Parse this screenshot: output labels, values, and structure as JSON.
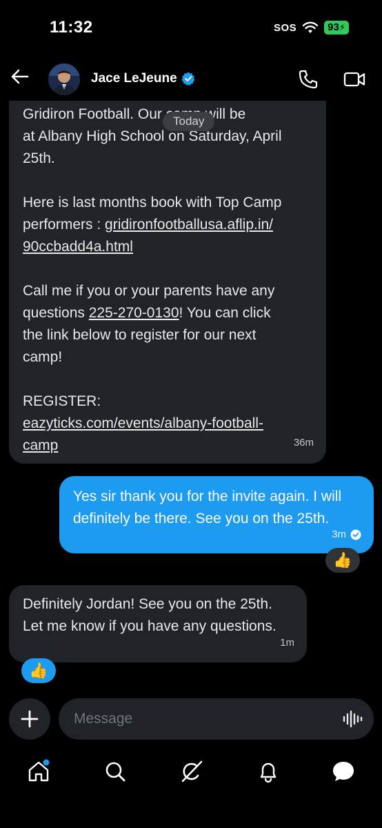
{
  "status_bar": {
    "time": "11:32",
    "sos": "SOS",
    "battery": "93"
  },
  "header": {
    "contact_name": "Jace LeJeune",
    "verified": true
  },
  "chat": {
    "date_separator": "Today",
    "messages": [
      {
        "direction": "incoming",
        "partial_top": "Gridiron Football. Our camp will be\nat Albany High School on Saturday, April\n25th.",
        "text_mid": "Here is last months book with Top Camp\nperformers : ",
        "link1": "gridironfootballusa.aflip.in/\n90ccbadd4a.html",
        "text_call": "Call me if you or your parents have any\nquestions ",
        "phone": "225-270-0130",
        "text_after_phone": "! You can click\nthe link below to register for our next\ncamp!",
        "register_label": "REGISTER:",
        "link2": "eazyticks.com/events/albany-football-\ncamp",
        "time": "36m"
      },
      {
        "direction": "outgoing",
        "text": "Yes sir thank you for the invite again. I will\ndefinitely be there. See you on the 25th.",
        "time": "3m",
        "reaction": "👍"
      },
      {
        "direction": "incoming",
        "text": "Definitely Jordan! See you on the 25th.\nLet me know if you have any questions.",
        "time": "1m",
        "reaction": "👍"
      }
    ]
  },
  "composer": {
    "placeholder": "Message"
  },
  "colors": {
    "accent": "#1d9bf0",
    "incoming_bubble": "#202327",
    "background": "#000000",
    "battery": "#34c759"
  },
  "nav_icons": [
    "home-icon",
    "search-icon",
    "grok-icon",
    "notifications-icon",
    "messages-icon"
  ]
}
